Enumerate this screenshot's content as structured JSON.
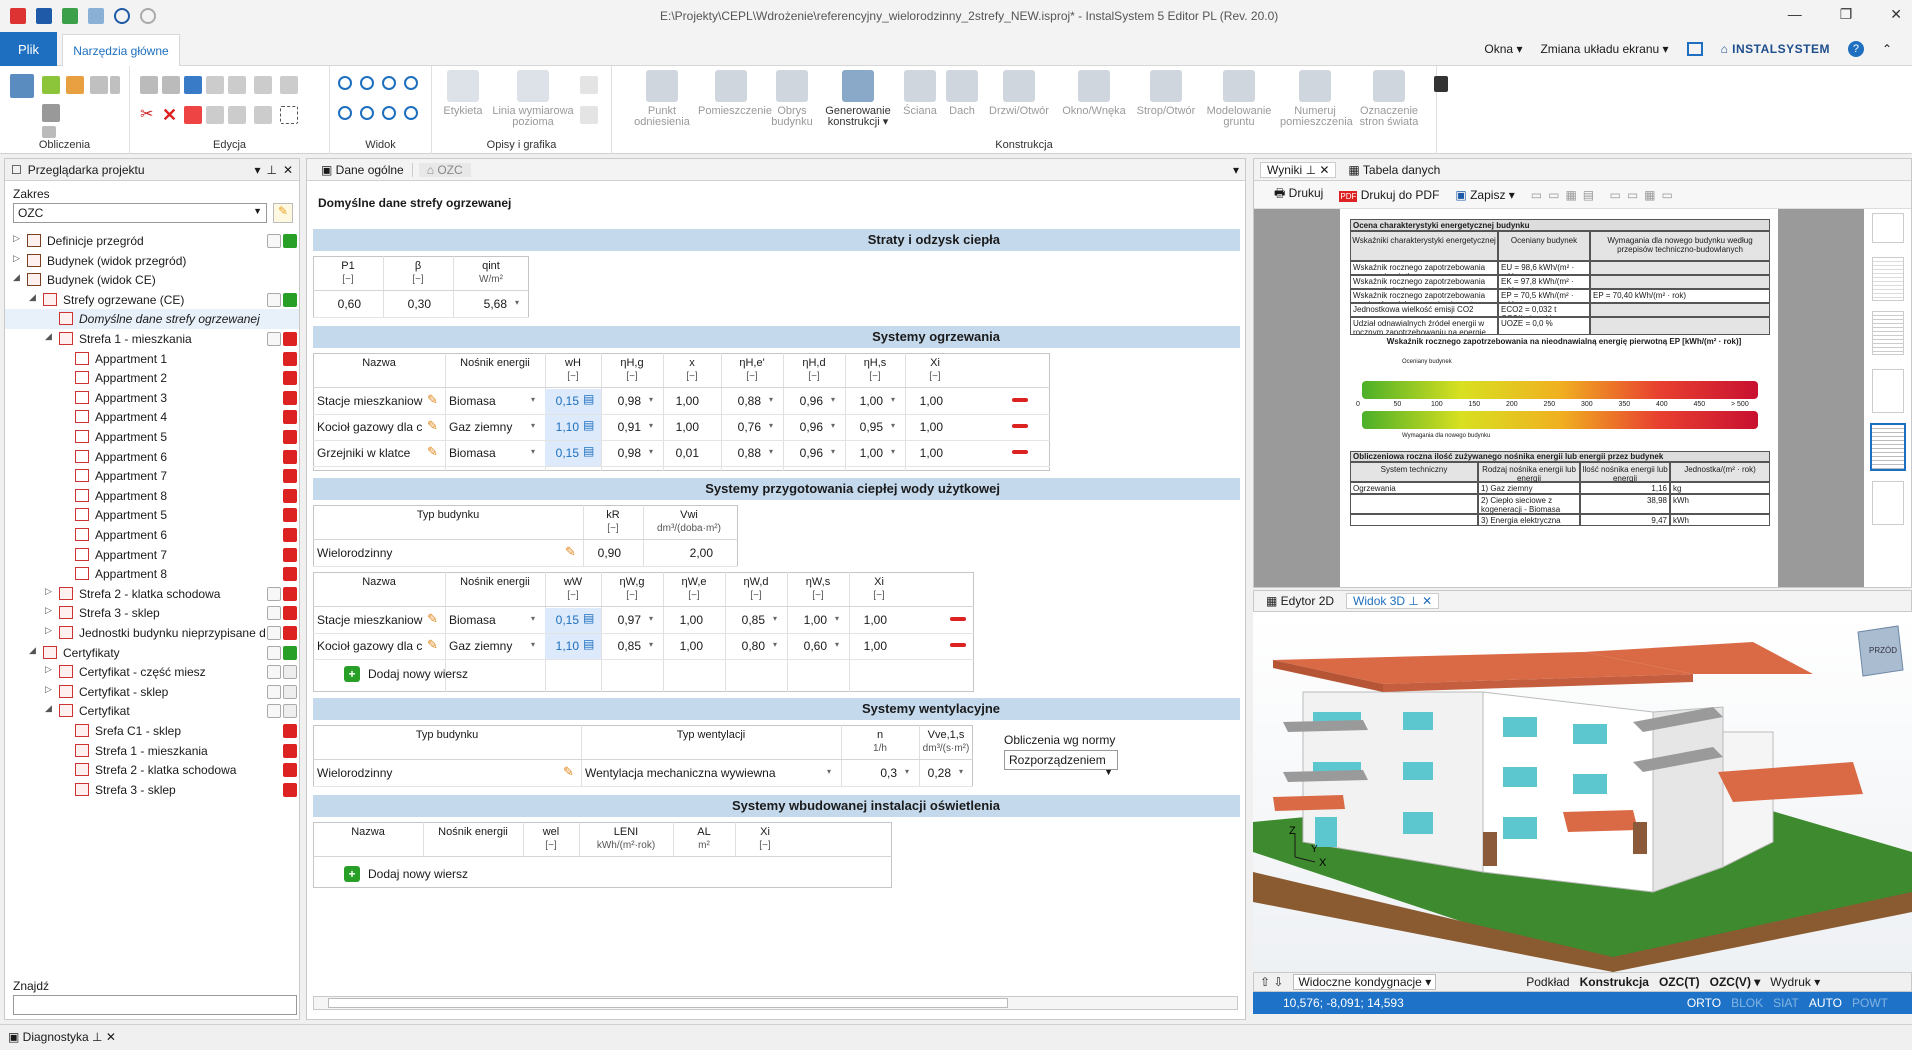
{
  "window": {
    "title": "E:\\Projekty\\CEPL\\Wdrożenie\\referencyjny_wielorodzinny_2strefy_NEW.isproj* - InstalSystem 5 Editor PL (Rev. 20.0)"
  },
  "ribbon": {
    "tab_file": "Plik",
    "tab_main": "Narzędzia główne",
    "right_items": [
      "Okna",
      "Zmiana układu ekranu"
    ],
    "logo": "INSTALSYSTEM",
    "groups": [
      "Obliczenia",
      "Edycja",
      "Widok",
      "Opisy i grafika",
      "Konstrukcja"
    ],
    "opisy_buttons": [
      "Etykieta",
      "Linia wymiarowa pozioma"
    ],
    "construction_buttons": [
      "Punkt odniesienia",
      "Pomieszczenie",
      "Obrys budynku",
      "Generowanie konstrukcji",
      "Ściana",
      "Dach",
      "Drzwi/Otwór",
      "Okno/Wnęka",
      "Strop/Otwór",
      "Modelowanie gruntu",
      "Numeruj pomieszczenia",
      "Oznaczenie stron świata"
    ]
  },
  "left_panel": {
    "title": "Przeglądarka projektu",
    "scope_label": "Zakres",
    "scope_value": "OZC",
    "find_label": "Znajdź",
    "tree": [
      {
        "label": "Definicje przegród",
        "level": 0,
        "expander": "▷"
      },
      {
        "label": "Budynek (widok przegród)",
        "level": 0,
        "expander": "▷"
      },
      {
        "label": "Budynek (widok CE)",
        "level": 0,
        "expander": "◢"
      },
      {
        "label": "Strefy ogrzewane (CE)",
        "level": 1,
        "expander": "◢"
      },
      {
        "label": "Domyślne dane strefy ogrzewanej",
        "level": 2,
        "expander": "",
        "selected": true
      },
      {
        "label": "Strefa 1 - mieszkania",
        "level": 2,
        "expander": "◢"
      },
      {
        "label": "Appartment 1",
        "level": 3,
        "expander": ""
      },
      {
        "label": "Appartment 2",
        "level": 3,
        "expander": ""
      },
      {
        "label": "Appartment 3",
        "level": 3,
        "expander": ""
      },
      {
        "label": "Appartment 4",
        "level": 3,
        "expander": ""
      },
      {
        "label": "Appartment 5",
        "level": 3,
        "expander": ""
      },
      {
        "label": "Appartment 6",
        "level": 3,
        "expander": ""
      },
      {
        "label": "Appartment 7",
        "level": 3,
        "expander": ""
      },
      {
        "label": "Appartment 8",
        "level": 3,
        "expander": ""
      },
      {
        "label": "Appartment 5",
        "level": 3,
        "expander": ""
      },
      {
        "label": "Appartment 6",
        "level": 3,
        "expander": ""
      },
      {
        "label": "Appartment 7",
        "level": 3,
        "expander": ""
      },
      {
        "label": "Appartment 8",
        "level": 3,
        "expander": ""
      },
      {
        "label": "Strefa 2 - klatka schodowa",
        "level": 2,
        "expander": "▷"
      },
      {
        "label": "Strefa 3 - sklep",
        "level": 2,
        "expander": "▷"
      },
      {
        "label": "Jednostki budynku nieprzypisane d",
        "level": 2,
        "expander": "▷"
      },
      {
        "label": "Certyfikaty",
        "level": 1,
        "expander": "◢"
      },
      {
        "label": "Certyfikat - część miesz",
        "level": 2,
        "expander": "▷"
      },
      {
        "label": "Certyfikat - sklep",
        "level": 2,
        "expander": "▷"
      },
      {
        "label": "Certyfikat",
        "level": 2,
        "expander": "◢"
      },
      {
        "label": "Srefa C1 - sklep",
        "level": 3,
        "expander": ""
      },
      {
        "label": "Strefa 1 - mieszkania",
        "level": 3,
        "expander": ""
      },
      {
        "label": "Strefa 2 - klatka schodowa",
        "level": 3,
        "expander": ""
      },
      {
        "label": "Strefa 3 - sklep",
        "level": 3,
        "expander": ""
      }
    ]
  },
  "center": {
    "tabs": [
      "Dane ogólne",
      "OZC"
    ],
    "page_title": "Domyślne dane strefy ogrzewanej",
    "sections": {
      "losses": "Straty i odzysk ciepła",
      "heating": "Systemy ogrzewania",
      "dhw": "Systemy przygotowania ciepłej wody użytkowej",
      "vent": "Systemy wentylacyjne",
      "light": "Systemy wbudowanej instalacji oświetlenia"
    },
    "losses": {
      "headers": [
        "P1",
        "β",
        "qint"
      ],
      "units": [
        "[−]",
        "[−]",
        "W/m²"
      ],
      "values": [
        "0,60",
        "0,30",
        "5,68"
      ]
    },
    "heating": {
      "headers": [
        "Nazwa",
        "Nośnik energii",
        "wH",
        "ηH,g",
        "x",
        "ηH,e'",
        "ηH,d",
        "ηH,s",
        "Xi"
      ],
      "units": [
        "",
        "",
        "[−]",
        "[−]",
        "[−]",
        "[−]",
        "[−]",
        "[−]",
        "[−]"
      ],
      "rows": [
        [
          "Stacje mieszkaniowe d",
          "Biomasa",
          "0,15",
          "0,98",
          "1,00",
          "0,88",
          "0,96",
          "1,00",
          "1,00"
        ],
        [
          "Kocioł gazowy dla c.o.",
          "Gaz ziemny",
          "1,10",
          "0,91",
          "1,00",
          "0,76",
          "0,96",
          "0,95",
          "1,00"
        ],
        [
          "Grzejniki w klatce",
          "Biomasa",
          "0,15",
          "0,98",
          "0,01",
          "0,88",
          "0,96",
          "1,00",
          "1,00"
        ]
      ]
    },
    "dhw_building": {
      "headers": [
        "Typ budynku",
        "kR",
        "Vwi"
      ],
      "units": [
        "",
        "[−]",
        "dm³/(doba·m²)"
      ],
      "row": [
        "Wielorodzinny",
        "0,90",
        "2,00"
      ]
    },
    "dhw": {
      "headers": [
        "Nazwa",
        "Nośnik energii",
        "wW",
        "ηW,g",
        "ηW,e",
        "ηW,d",
        "ηW,s",
        "Xi"
      ],
      "units": [
        "",
        "",
        "[−]",
        "[−]",
        "[−]",
        "[−]",
        "[−]",
        "[−]"
      ],
      "rows": [
        [
          "Stacje mieszkaniowe d",
          "Biomasa",
          "0,15",
          "0,97",
          "1,00",
          "0,85",
          "1,00",
          "1,00"
        ],
        [
          "Kocioł gazowy dla c.w.",
          "Gaz ziemny",
          "1,10",
          "0,85",
          "1,00",
          "0,80",
          "0,60",
          "1,00"
        ]
      ],
      "add_row": "Dodaj nowy wiersz"
    },
    "vent": {
      "headers": [
        "Typ budynku",
        "Typ wentylacji",
        "n",
        "Vve,1,s"
      ],
      "units": [
        "",
        "",
        "1/h",
        "dm³/(s·m²)"
      ],
      "row": [
        "Wielorodzinny",
        "Wentylacja mechaniczna wywiewna",
        "0,3",
        "0,28"
      ],
      "norm_label": "Obliczenia wg normy",
      "norm_value": "Rozporządzeniem"
    },
    "light": {
      "headers": [
        "Nazwa",
        "Nośnik energii",
        "wel",
        "LENI",
        "AL",
        "Xi"
      ],
      "units": [
        "",
        "",
        "[−]",
        "kWh/(m²·rok)",
        "m²",
        "[−]"
      ],
      "add_row": "Dodaj nowy wiersz"
    }
  },
  "right_panel": {
    "tabs": [
      "Wyniki",
      "Tabela danych"
    ],
    "toolbar": [
      "Drukuj",
      "Drukuj do PDF",
      "Zapisz"
    ],
    "report": {
      "title": "Ocena charakterystyki energetycznej budynku",
      "col_headers": [
        "Wskaźniki charakterystyki energetycznej",
        "Oceniany budynek",
        "Wymagania dla nowego budynku według przepisów techniczno-budowlanych"
      ],
      "rows": [
        [
          "Wskaźnik rocznego zapotrzebowania na energię użytkową",
          "EU = 98,6 kWh/(m² · rok)",
          ""
        ],
        [
          "Wskaźnik rocznego zapotrzebowania na energię końcową",
          "EK = 97,8 kWh/(m² · rok)",
          ""
        ],
        [
          "Wskaźnik rocznego zapotrzebowania na nieodnawialną energię pierwotną",
          "EP = 70,5 kWh/(m² · rok)",
          "EP = 70,40 kWh/(m² · rok)"
        ],
        [
          "Jednostkowa wielkość emisji CO2",
          "ECO2 = 0,032 t CO2/(m² · rok)",
          ""
        ],
        [
          "Udział odnawialnych źródeł energii w rocznym zapotrzebowaniu na energię końcową",
          "UOZE = 0,0 %",
          ""
        ]
      ],
      "scale_title": "Wskaźnik rocznego zapotrzebowania na nieodnawialną energię pierwotną EP [kWh/(m² · rok)]",
      "scale_label_top": "Oceniany budynek",
      "scale_label_bottom": "Wymagania dla nowego budynku",
      "scale_ticks": [
        "0",
        "50",
        "100",
        "150",
        "200",
        "250",
        "300",
        "350",
        "400",
        "450",
        "> 500"
      ],
      "table2_title": "Obliczeniowa roczna ilość zużywanego nośnika energii lub energii przez budynek",
      "table2_headers": [
        "System techniczny",
        "Rodzaj nośnika energii lub energii",
        "Ilość nośnika energii lub energii",
        "Jednostka/(m² · rok)"
      ],
      "table2_rows": [
        [
          "Ogrzewania",
          "1) Gaz ziemny",
          "1,16",
          "kg"
        ],
        [
          "",
          "2) Ciepło sieciowe z kogeneracji - Biomasa",
          "38,98",
          "kWh"
        ],
        [
          "",
          "3) Energia elektryczna",
          "9,47",
          "kWh"
        ]
      ]
    }
  },
  "view_panel": {
    "tabs": [
      "Edytor 2D",
      "Widok 3D"
    ],
    "cube_label": "PRZÓD",
    "bottom": [
      "Widoczne kondygnacje",
      "Podkład",
      "Konstrukcja",
      "OZC(T)",
      "OZC(V)",
      "Wydruk"
    ],
    "status": {
      "coords": "10,576; -8,091; 14,593",
      "modes": [
        "ORTO",
        "BLOK",
        "SIAT",
        "AUTO",
        "POWT"
      ]
    }
  },
  "bottom_tab": "Diagnostyka"
}
